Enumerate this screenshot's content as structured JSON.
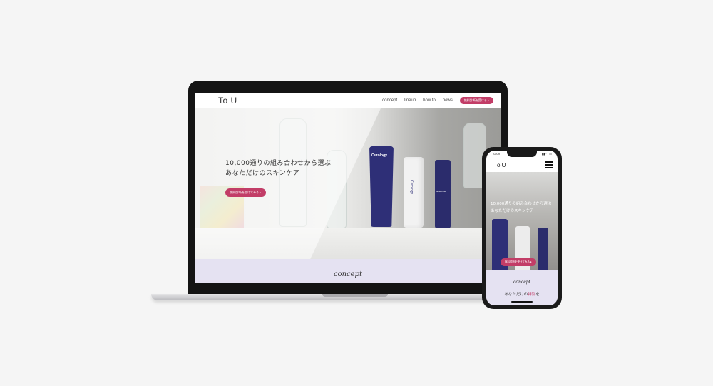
{
  "desktop": {
    "logo": "To U",
    "nav": [
      {
        "label": "concept"
      },
      {
        "label": "lineup"
      },
      {
        "label": "how to"
      },
      {
        "label": "news"
      }
    ],
    "nav_cta": "無料診断を受ける ▸",
    "hero": {
      "headline_line1": "10,000通りの組み合わせから選ぶ",
      "headline_line2": "あなただけのスキンケア",
      "cta": "無料診断を受けてみる ▸",
      "product_tube_label": "Curology",
      "product_white_label": "Curology",
      "product_navy_label": "Moisturizer"
    },
    "section_title": "concept"
  },
  "mobile": {
    "status_time": "22:09",
    "status_icons": "▮▮ ◠ ▭",
    "logo": "To U",
    "hero": {
      "headline_line1": "10,000通りの組み合わせから選ぶ",
      "headline_line2": "あなただけのスキンケア",
      "cta": "無料診断を受けてみる ▸"
    },
    "section_title": "concept",
    "tagline_prefix": "あなただけの",
    "tagline_accent": "特別",
    "tagline_suffix": "を"
  },
  "colors": {
    "accent": "#c23d67",
    "navy": "#2e2f77",
    "lavender": "#e5e2f2"
  }
}
